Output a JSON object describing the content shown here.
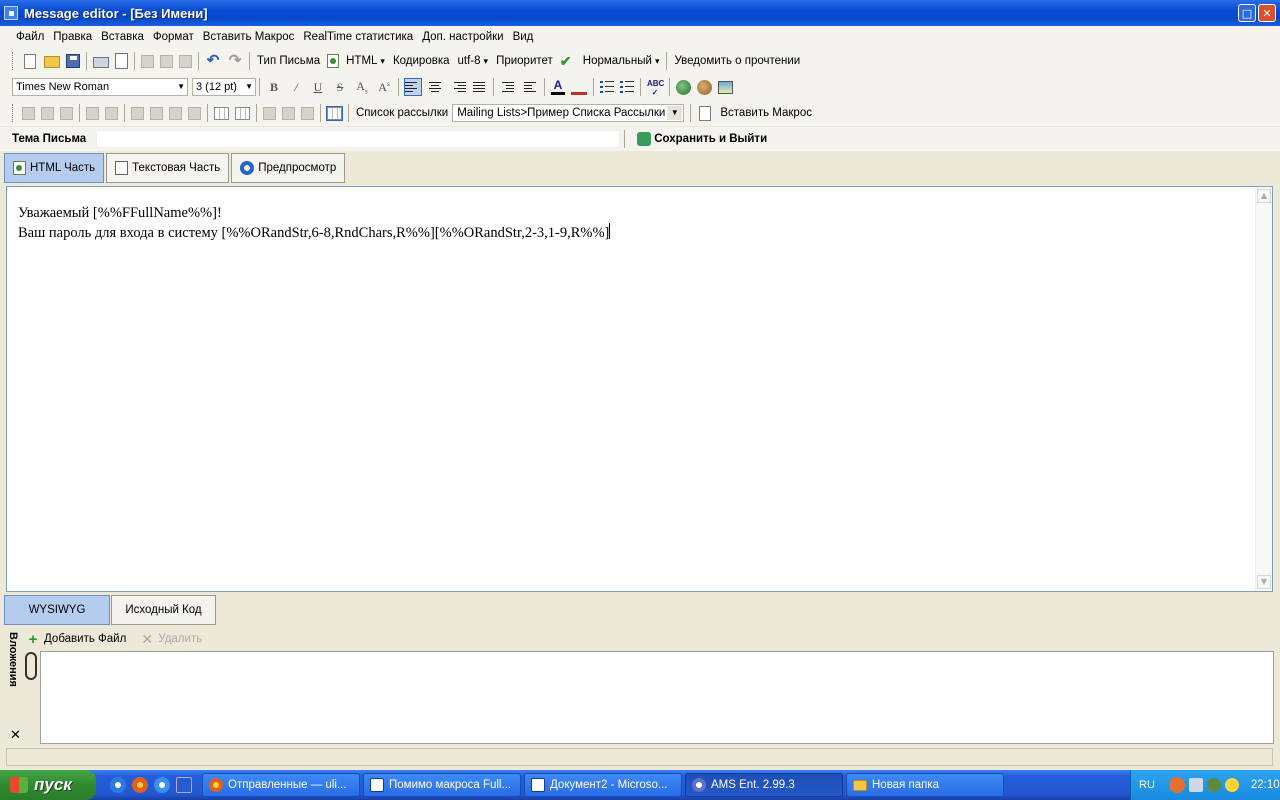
{
  "window": {
    "title": "Message editor - [Без Имени]"
  },
  "menu": [
    "Файл",
    "Правка",
    "Вставка",
    "Формат",
    "Вставить Макрос",
    "RealTime статистика",
    "Доп. настройки",
    "Вид"
  ],
  "toolbar1": {
    "mail_type_label": "Тип Письма",
    "mail_type_value": "HTML",
    "encoding_label": "Кодировка",
    "encoding_value": "utf-8",
    "priority_label": "Приоритет",
    "priority_value": "Нормальный",
    "read_receipt_label": "Уведомить о прочтении"
  },
  "toolbar2": {
    "font_family": "Times New Roman",
    "font_size": "3  (12 pt)"
  },
  "toolbar3": {
    "mailing_list_label": "Список рассылки",
    "mailing_list_value": "Mailing Lists>Пример Списка Рассылки",
    "insert_macro_label": "Вставить Макрос"
  },
  "subject": {
    "label": "Тема Письма",
    "value": "",
    "save_exit_label": "Сохранить и Выйти"
  },
  "tabs": [
    "HTML Часть",
    "Текстовая Часть",
    "Предпросмотр"
  ],
  "editor": {
    "line1": "Уважаемый [%%FFullName%%]!",
    "line2": "Ваш пароль для входа в систему [%%ORandStr,6-8,RndChars,R%%][%%ORandStr,2-3,1-9,R%%]"
  },
  "view_tabs": [
    "WYSIWYG",
    "Исходный Код"
  ],
  "attachments": {
    "pane_label": "Вложения",
    "add_label": "Добавить Файл",
    "delete_label": "Удалить"
  },
  "taskbar": {
    "start_label": "пуск",
    "tasks": [
      "Отправленные — uli...",
      "Помимо макроса Full...",
      "Документ2 - Microso...",
      "AMS Ent. 2.99.3",
      "Новая папка"
    ],
    "lang": "RU",
    "clock": "22:10"
  }
}
